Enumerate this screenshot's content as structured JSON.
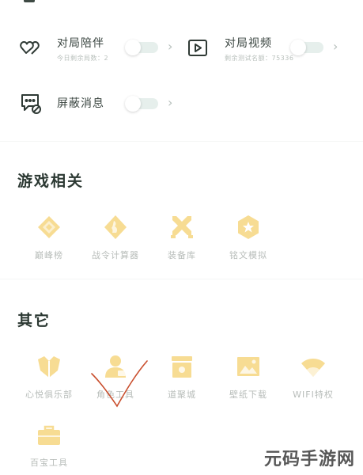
{
  "settings": {
    "companion": {
      "title": "对局陪伴",
      "sub": "今日剩余局数：2"
    },
    "video": {
      "title": "对局视频",
      "sub": "剩余测试名额：75336"
    },
    "block": {
      "title": "屏蔽消息"
    },
    "chevron": "›"
  },
  "games": {
    "title": "游戏相关",
    "items": [
      {
        "label": "巅峰榜",
        "icon": "diamond-icon"
      },
      {
        "label": "战令计算器",
        "icon": "rabbit-icon"
      },
      {
        "label": "装备库",
        "icon": "crossed-swords-icon"
      },
      {
        "label": "铭文模拟",
        "icon": "hexagon-star-icon"
      }
    ]
  },
  "others": {
    "title": "其它",
    "items": [
      {
        "label": "心悦俱乐部",
        "icon": "heart-badge-icon"
      },
      {
        "label": "角色工具",
        "icon": "person-icon"
      },
      {
        "label": "道聚城",
        "icon": "shop-icon"
      },
      {
        "label": "壁纸下载",
        "icon": "image-icon"
      },
      {
        "label": "WIFI特权",
        "icon": "wifi-icon"
      },
      {
        "label": "百宝工具",
        "icon": "toolbox-icon"
      }
    ]
  },
  "colors": {
    "accent_icon": "#f7dc93",
    "toggle_off": "#e6efec",
    "scribble": "#c94e2d"
  },
  "watermark": "元码手游网"
}
